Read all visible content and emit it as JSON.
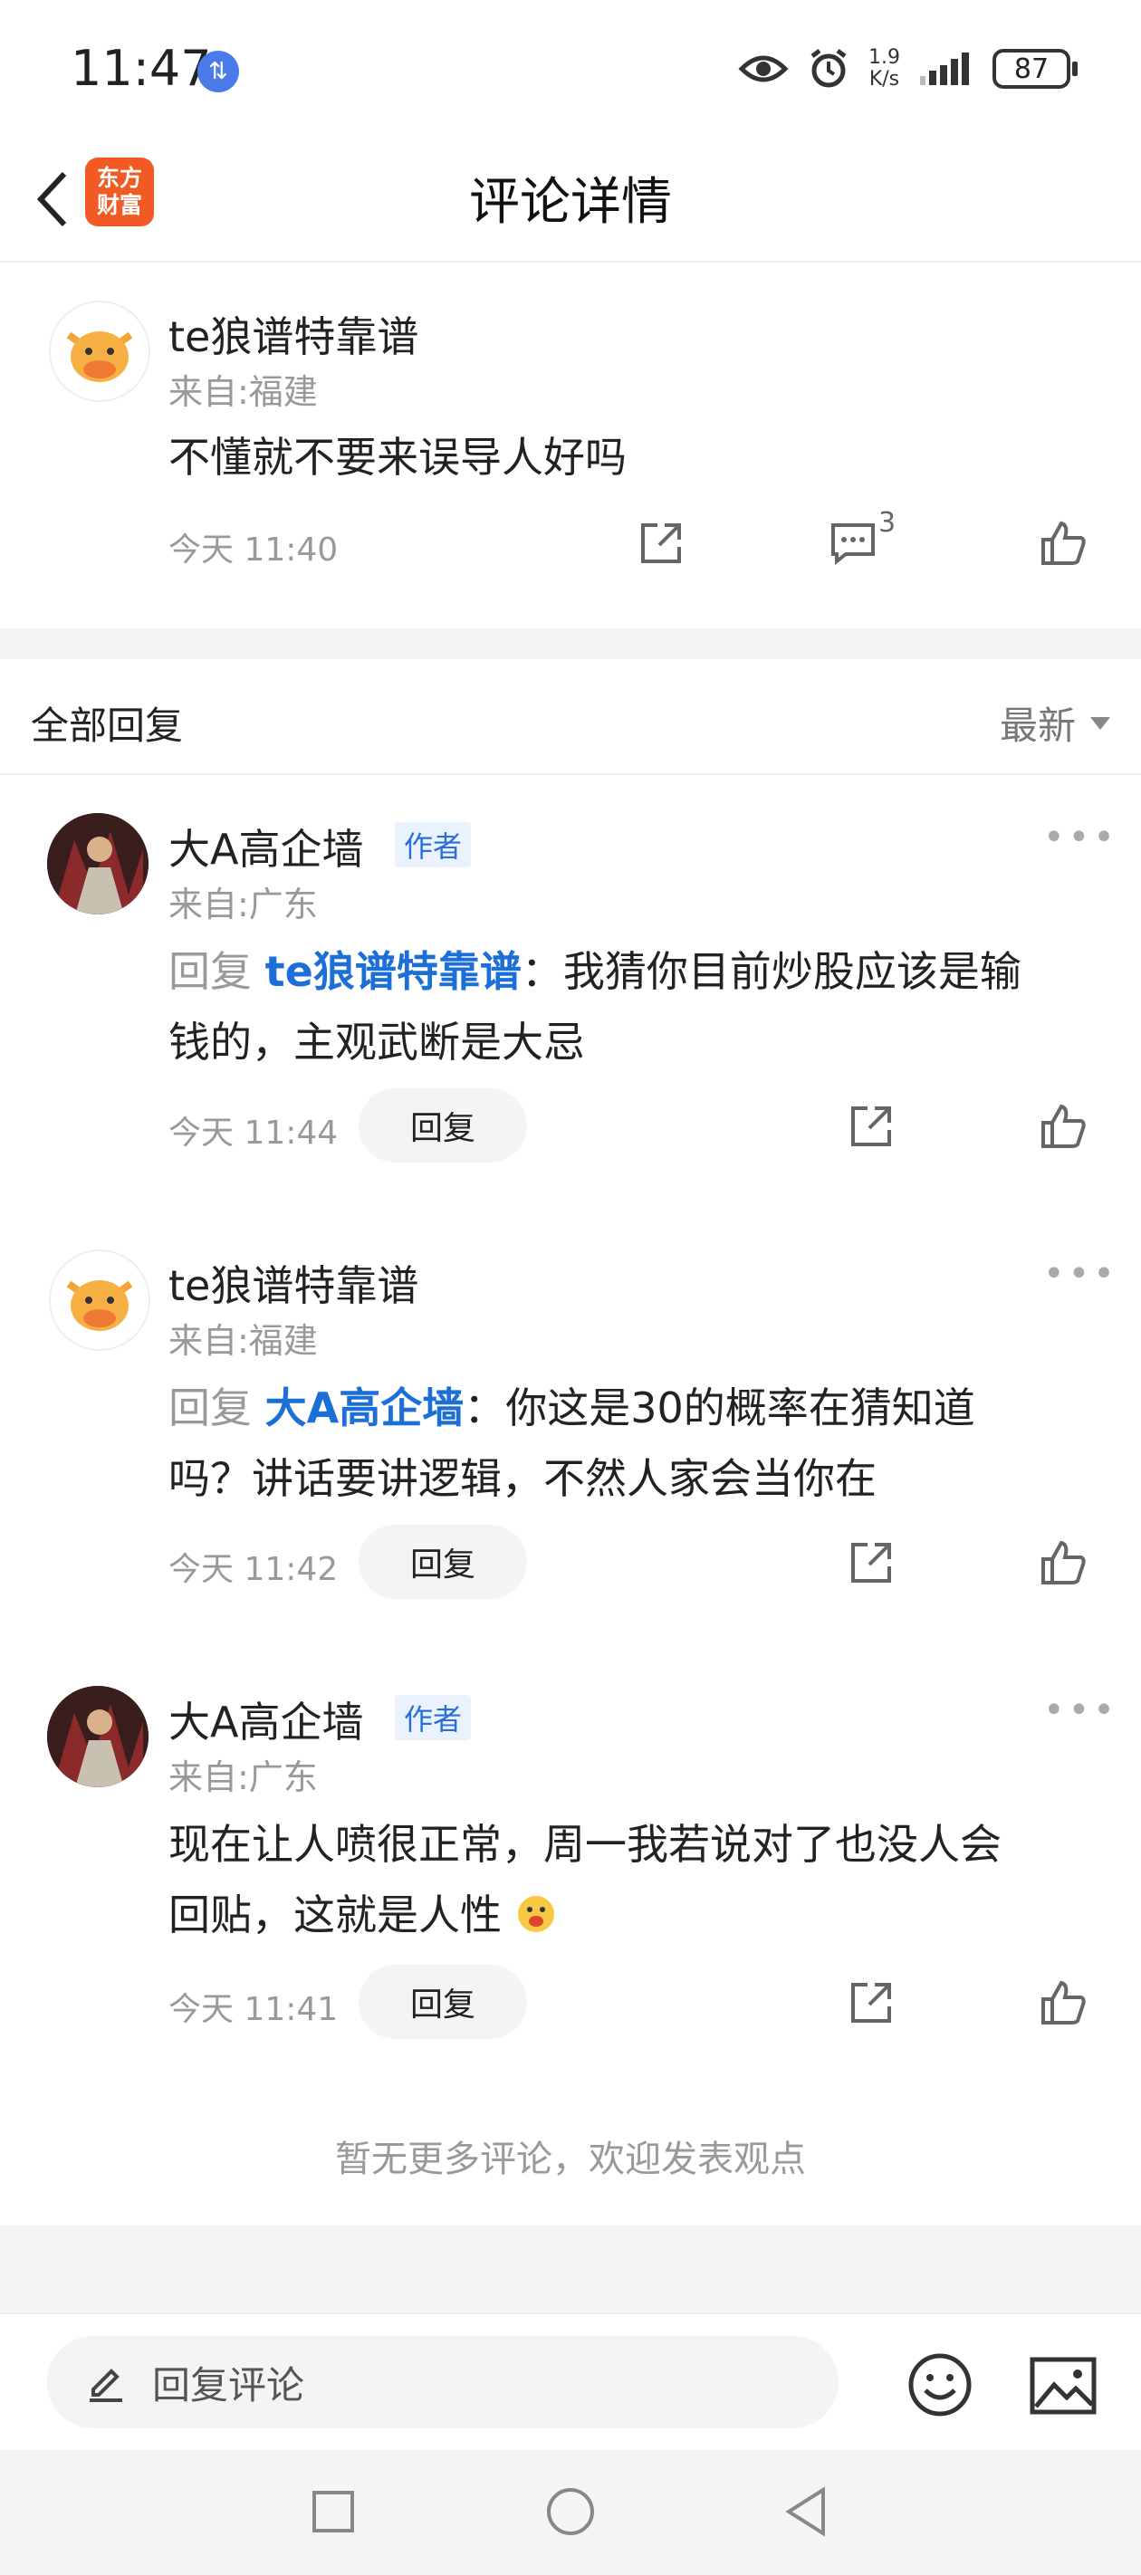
{
  "status_bar": {
    "time": "11:47",
    "speed_top": "1.9",
    "speed_unit": "K/s",
    "battery": "87"
  },
  "nav": {
    "title": "评论详情",
    "logo_line1": "东方",
    "logo_line2": "财富"
  },
  "main_comment": {
    "user": "te狼谱特靠谱",
    "from": "来自:福建",
    "text": "不懂就不要来误导人好吗",
    "time": "今天 11:40",
    "comment_count": "3"
  },
  "replies_section": {
    "title": "全部回复",
    "sort_label": "最新"
  },
  "replies": [
    {
      "user": "大A高企墙",
      "tag": "作者",
      "from": "来自:广东",
      "prefix": "回复",
      "target": "te狼谱特靠谱",
      "line1": "：我猜你目前炒股应该是输",
      "line2": "钱的，主观武断是大忌",
      "time": "今天 11:44",
      "reply_label": "回复",
      "avatar_icon": "avatar-image"
    },
    {
      "user": "te狼谱特靠谱",
      "tag": "",
      "from": "来自:福建",
      "prefix": "回复",
      "target": "大A高企墙",
      "line1": "：你这是30的概率在猜知道",
      "line2": "吗？讲话要讲逻辑，不然人家会当你在",
      "time": "今天 11:42",
      "reply_label": "回复",
      "avatar_icon": "cow-avatar"
    },
    {
      "user": "大A高企墙",
      "tag": "作者",
      "from": "来自:广东",
      "line1": "现在让人喷很正常，周一我若说对了也没人会",
      "line2": "回贴，这就是人性",
      "time": "今天 11:41",
      "reply_label": "回复",
      "avatar_icon": "avatar-image"
    }
  ],
  "end_note": "暂无更多评论，欢迎发表观点",
  "bottom_bar": {
    "input_placeholder": "回复评论"
  },
  "colors": {
    "accent_blue": "#1b6fd6",
    "logo_orange": "#f15a22"
  }
}
